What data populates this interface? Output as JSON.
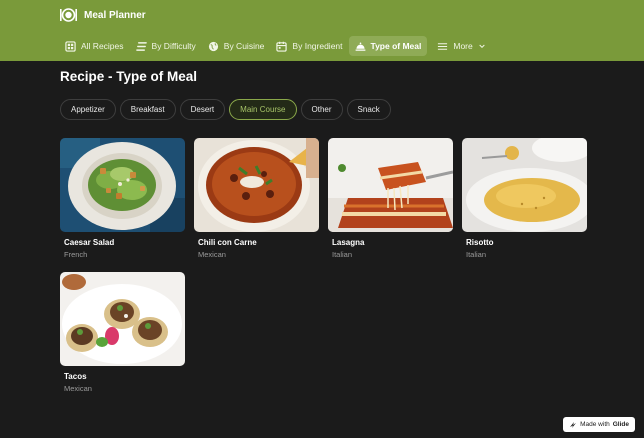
{
  "app": {
    "name": "Meal Planner",
    "logo_icon": "meal-logo-icon"
  },
  "nav": [
    {
      "label": "All Recipes",
      "icon": "grid-icon"
    },
    {
      "label": "By Difficulty",
      "icon": "bars-icon"
    },
    {
      "label": "By Cuisine",
      "icon": "globe-icon"
    },
    {
      "label": "By Ingredient",
      "icon": "calendar-icon"
    },
    {
      "label": "Type of Meal",
      "icon": "cloche-icon",
      "active": true
    },
    {
      "label": "More",
      "icon": "menu-icon"
    }
  ],
  "page": {
    "title": "Recipe - Type of Meal"
  },
  "filters": [
    {
      "label": "Appetizer"
    },
    {
      "label": "Breakfast"
    },
    {
      "label": "Desert"
    },
    {
      "label": "Main Course",
      "selected": true
    },
    {
      "label": "Other"
    },
    {
      "label": "Snack"
    }
  ],
  "recipes": [
    {
      "name": "Caesar Salad",
      "cuisine": "French"
    },
    {
      "name": "Chili con Carne",
      "cuisine": "Mexican"
    },
    {
      "name": "Lasagna",
      "cuisine": "Italian"
    },
    {
      "name": "Risotto",
      "cuisine": "Italian"
    },
    {
      "name": "Tacos",
      "cuisine": "Mexican"
    }
  ],
  "badge": {
    "prefix": "Made with",
    "brand": "Glide"
  },
  "colors": {
    "header": "#7a9a3a",
    "background": "#1b1b1b",
    "accent": "#a7c468"
  }
}
